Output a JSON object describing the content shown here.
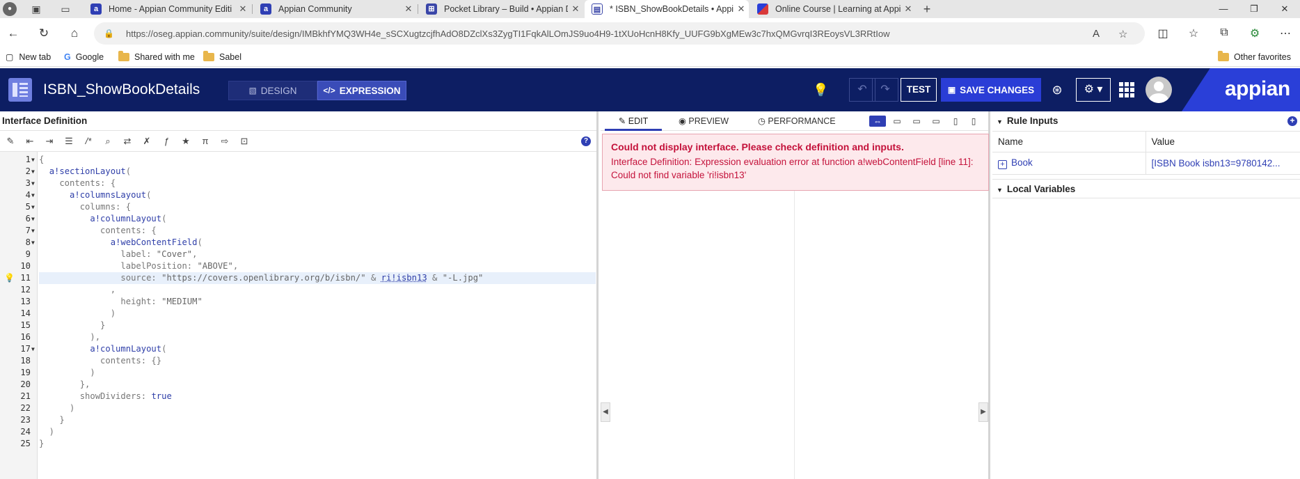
{
  "browser": {
    "tabs": [
      {
        "title": "Home - Appian Community Editi",
        "favicon": "appian",
        "active": false
      },
      {
        "title": "Appian Community",
        "favicon": "appian",
        "active": false
      },
      {
        "title": "Pocket Library – Build • Appian D",
        "favicon": "build",
        "active": false
      },
      {
        "title": "* ISBN_ShowBookDetails • Appia",
        "favicon": "interface",
        "active": true
      },
      {
        "title": "Online Course | Learning at Appi",
        "favicon": "course",
        "active": false
      }
    ],
    "new_tab_symbol": "+",
    "url": "https://oseg.appian.community/suite/design/IMBkhfYMQ3WH4e_sSCXugtzcjfhAdO8DZclXs3ZygTI1FqkAlLOmJS9uo4H9-1tXUoHcnH8Kfy_UUFG9bXgMEw3c7hxQMGvrqI3REoysVL3RRtIow",
    "url_host": "oseg.appian.community",
    "bookmarks": [
      "New tab",
      "Google",
      "Shared with me",
      "Sabel"
    ],
    "other_favorites": "Other favorites"
  },
  "header": {
    "title": "ISBN_ShowBookDetails",
    "design_label": "DESIGN",
    "expression_label": "EXPRESSION",
    "test_label": "TEST",
    "save_label": "SAVE CHANGES",
    "brand": "appian",
    "brand_color": "#2a3fd8",
    "bar_color": "#0d1e63"
  },
  "left": {
    "title": "Interface Definition",
    "code_lines": [
      "{",
      "  a!sectionLayout(",
      "    contents: {",
      "      a!columnsLayout(",
      "        columns: {",
      "          a!columnLayout(",
      "            contents: {",
      "              a!webContentField(",
      "                label: \"Cover\",",
      "                labelPosition: \"ABOVE\",",
      "                source: \"https://covers.openlibrary.org/b/isbn/\" & ri!isbn13 & \"-L.jpg\"",
      "              ,",
      "                height: \"MEDIUM\"",
      "              )",
      "            }",
      "          ),",
      "          a!columnLayout(",
      "            contents: {}",
      "          )",
      "        },",
      "        showDividers: true",
      "      )",
      "    }",
      "  )",
      "}"
    ],
    "folded_lines": [
      1,
      2,
      3,
      4,
      5,
      6,
      7,
      8,
      17
    ],
    "highlight_line": 11
  },
  "center": {
    "tabs": [
      "EDIT",
      "PREVIEW",
      "PERFORMANCE"
    ],
    "error_title": "Could not display interface. Please check definition and inputs.",
    "error_message": "Interface Definition: Expression evaluation error at function a!webContentField [line 11]: Could not find variable 'ri!isbn13'",
    "error_color": "#c4123b"
  },
  "right": {
    "rule_inputs_title": "Rule Inputs",
    "columns": [
      "Name",
      "Value"
    ],
    "rows": [
      {
        "name": "Book",
        "value": "[ISBN Book isbn13=9780142..."
      }
    ],
    "local_variables_title": "Local Variables"
  }
}
